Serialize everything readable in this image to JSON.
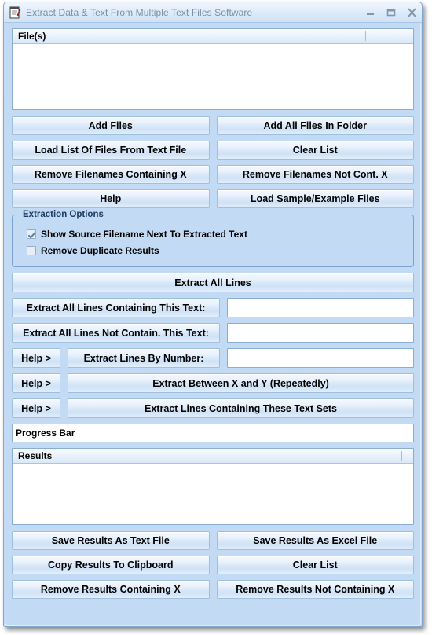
{
  "window": {
    "title": "Extract Data & Text From Multiple Text Files Software",
    "app_icon": "document-pen-icon",
    "minimize_label": "–",
    "maximize_label": "▭",
    "close_label": "X",
    "background_color": "#c2daf4",
    "titlebar_text_color": "#7d8ea3"
  },
  "files_list": {
    "header": "File(s)",
    "rows": [],
    "column_separator": true
  },
  "file_buttons": [
    {
      "label": "Add Files",
      "name": "add-files-button"
    },
    {
      "label": "Add All Files In Folder",
      "name": "add-all-files-in-folder-button"
    },
    {
      "label": "Load List Of Files From Text File",
      "name": "load-list-of-files-button"
    },
    {
      "label": "Clear List",
      "name": "clear-list-files-button"
    },
    {
      "label": "Remove Filenames Containing X",
      "name": "remove-filenames-containing-button"
    },
    {
      "label": "Remove Filenames Not Cont. X",
      "name": "remove-filenames-not-containing-button"
    },
    {
      "label": "Help",
      "name": "help-button"
    },
    {
      "label": "Load Sample/Example Files",
      "name": "load-sample-files-button"
    }
  ],
  "extraction_options": {
    "title": "Extraction Options",
    "checkboxes": [
      {
        "label": "Show Source Filename Next To Extracted Text",
        "checked": true
      },
      {
        "label": "Remove Duplicate Results",
        "checked": false
      }
    ]
  },
  "extract_actions": {
    "extract_all_lines": "Extract All Lines",
    "rows": [
      {
        "help": null,
        "button": "Extract All Lines Containing This Text:",
        "input_value": "",
        "input_placeholder": ""
      },
      {
        "help": null,
        "button": "Extract All Lines Not Contain. This Text:",
        "input_value": "",
        "input_placeholder": ""
      },
      {
        "help": "Help >",
        "button": "Extract Lines By Number:",
        "input_value": "",
        "input_placeholder": ""
      }
    ],
    "wide_rows": [
      {
        "help": "Help >",
        "button": "Extract Between X and Y (Repeatedly)"
      },
      {
        "help": "Help >",
        "button": "Extract Lines Containing These Text Sets"
      }
    ]
  },
  "progress": {
    "text": "Progress Bar",
    "value": 0
  },
  "results_list": {
    "header": "Results",
    "rows": [],
    "column_separator": true
  },
  "results_buttons": [
    {
      "label": "Save Results As Text File",
      "name": "save-results-as-text-file-button"
    },
    {
      "label": "Save Results As Excel File",
      "name": "save-results-as-excel-file-button"
    },
    {
      "label": "Copy Results To Clipboard",
      "name": "copy-results-to-clipboard-button"
    },
    {
      "label": "Clear List",
      "name": "clear-list-results-button"
    },
    {
      "label": "Remove Results Containing X",
      "name": "remove-results-containing-button"
    },
    {
      "label": "Remove Results Not Containing X",
      "name": "remove-results-not-containing-button"
    }
  ]
}
